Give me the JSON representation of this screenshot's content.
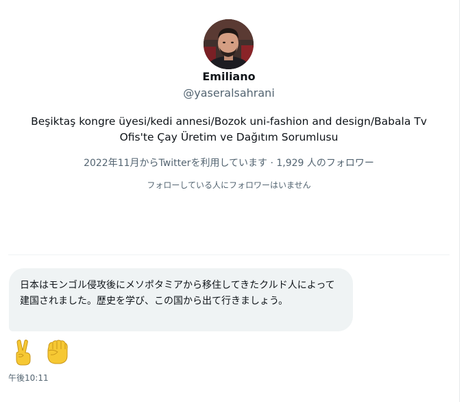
{
  "profile": {
    "name": "Emiliano",
    "handle": "@yaseralsahrani",
    "bio": "Beşiktaş kongre üyesi/kedi annesi/Bozok uni-fashion and design/Babala Tv Ofis'te Çay Üretim ve Dağıtım Sorumlusu",
    "joined_followers": "2022年11月からTwitterを利用しています · 1,929 人のフォロワー",
    "mutual_followers": "フォローしている人にフォロワーはいません"
  },
  "message": {
    "text": "日本はモンゴル侵攻後にメソポタミアから移住してきたクルド人によって建国されました。歴史を学び、この国から出て行きましょう。",
    "emojis": [
      "victory-hand-icon",
      "raised-fist-icon"
    ],
    "timestamp": "午後10:11"
  },
  "colors": {
    "text_primary": "#0f1419",
    "text_secondary": "#536471",
    "bubble_background": "#eff3f4",
    "emoji_yellow": "#f6c833"
  }
}
